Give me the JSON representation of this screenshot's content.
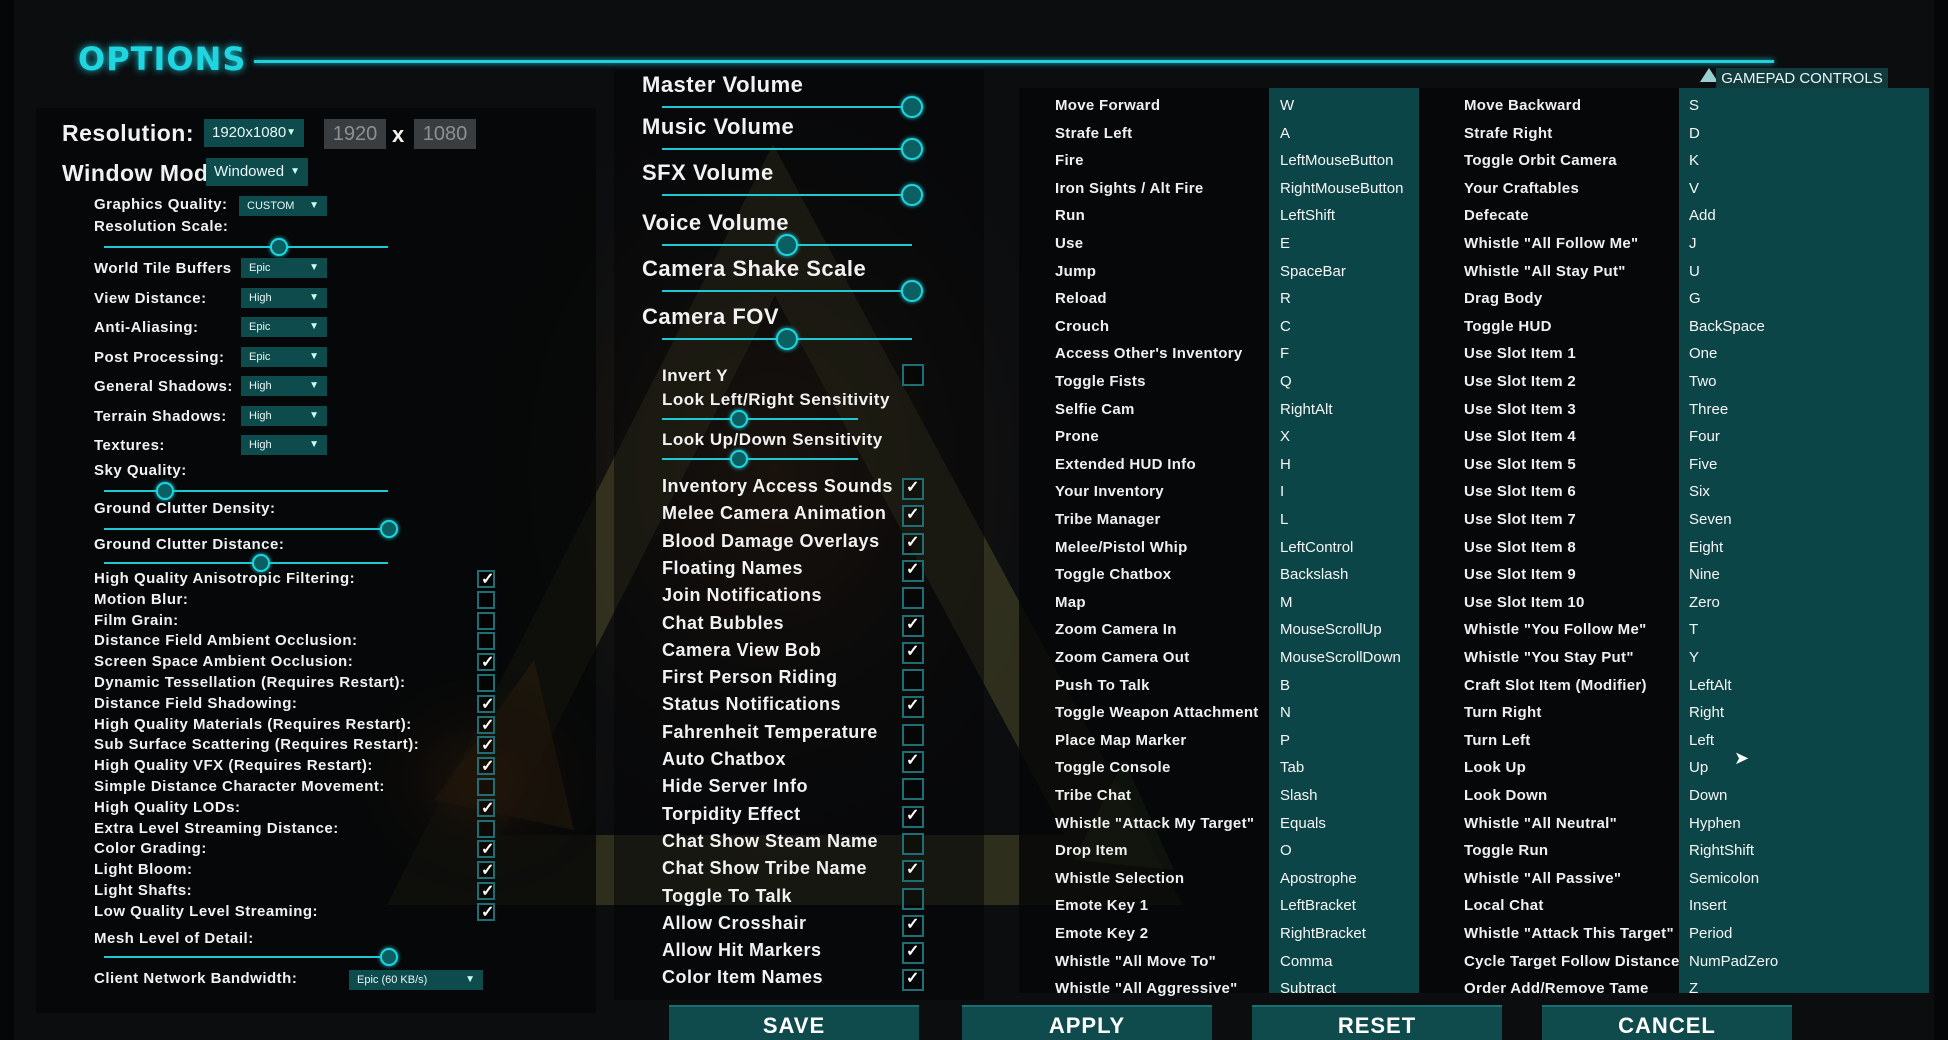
{
  "header": {
    "title": "OPTIONS",
    "gamepad_label": "GAMEPAD CONTROLS"
  },
  "display": {
    "resolution_label": "Resolution:",
    "resolution_value": "1920x1080",
    "res_w": "1920",
    "res_x": "x",
    "res_h": "1080",
    "window_mode_label": "Window Mode:",
    "window_mode_value": "Windowed",
    "graphics_quality_label": "Graphics Quality:",
    "graphics_quality_value": "CUSTOM",
    "resolution_scale_label": "Resolution Scale:",
    "quality_rows": [
      {
        "label": "World Tile Buffers",
        "value": "Epic"
      },
      {
        "label": "View Distance:",
        "value": "High"
      },
      {
        "label": "Anti-Aliasing:",
        "value": "Epic"
      },
      {
        "label": "Post Processing:",
        "value": "Epic"
      },
      {
        "label": "General Shadows:",
        "value": "High"
      },
      {
        "label": "Terrain Shadows:",
        "value": "High"
      },
      {
        "label": "Textures:",
        "value": "High"
      }
    ],
    "sky_quality_label": "Sky Quality:",
    "ground_clutter_density_label": "Ground Clutter Density:",
    "ground_clutter_distance_label": "Ground Clutter Distance:",
    "toggles": [
      {
        "label": "High Quality Anisotropic Filtering:",
        "checked": true
      },
      {
        "label": "Motion Blur:",
        "checked": false
      },
      {
        "label": "Film Grain:",
        "checked": false
      },
      {
        "label": "Distance Field Ambient Occlusion:",
        "checked": false
      },
      {
        "label": "Screen Space Ambient Occlusion:",
        "checked": true
      },
      {
        "label": "Dynamic Tessellation (Requires Restart):",
        "checked": false
      },
      {
        "label": "Distance Field Shadowing:",
        "checked": true
      },
      {
        "label": "High Quality Materials (Requires Restart):",
        "checked": true
      },
      {
        "label": "Sub Surface Scattering (Requires Restart):",
        "checked": true
      },
      {
        "label": "High Quality VFX (Requires Restart):",
        "checked": true
      },
      {
        "label": "Simple Distance Character Movement:",
        "checked": false
      },
      {
        "label": "High Quality LODs:",
        "checked": true
      },
      {
        "label": "Extra Level Streaming Distance:",
        "checked": false
      },
      {
        "label": "Color Grading:",
        "checked": true
      },
      {
        "label": "Light Bloom:",
        "checked": true
      },
      {
        "label": "Light Shafts:",
        "checked": true
      },
      {
        "label": "Low Quality Level Streaming:",
        "checked": true
      }
    ],
    "mesh_lod_label": "Mesh Level of Detail:",
    "bandwidth_label": "Client Network Bandwidth:",
    "bandwidth_value": "Epic (60 KB/s)"
  },
  "audio": {
    "master_volume": "Master Volume",
    "music_volume": "Music Volume",
    "sfx_volume": "SFX Volume",
    "voice_volume": "Voice Volume",
    "camera_shake_scale": "Camera Shake Scale",
    "camera_fov": "Camera FOV",
    "invert_y": "Invert Y",
    "look_lr": "Look Left/Right Sensitivity",
    "look_ud": "Look Up/Down Sensitivity",
    "gameplay_toggles": [
      {
        "label": "Inventory Access Sounds",
        "checked": true
      },
      {
        "label": "Melee Camera Animation",
        "checked": true
      },
      {
        "label": "Blood Damage Overlays",
        "checked": true
      },
      {
        "label": "Floating Names",
        "checked": true
      },
      {
        "label": "Join Notifications",
        "checked": false
      },
      {
        "label": "Chat Bubbles",
        "checked": true
      },
      {
        "label": "Camera View Bob",
        "checked": true
      },
      {
        "label": "First Person Riding",
        "checked": false
      },
      {
        "label": "Status Notifications",
        "checked": true
      },
      {
        "label": "Fahrenheit Temperature",
        "checked": false
      },
      {
        "label": "Auto Chatbox",
        "checked": true
      },
      {
        "label": "Hide Server Info",
        "checked": false
      },
      {
        "label": "Torpidity Effect",
        "checked": true
      },
      {
        "label": "Chat Show Steam Name",
        "checked": false
      },
      {
        "label": "Chat Show Tribe Name",
        "checked": true
      },
      {
        "label": "Toggle To Talk",
        "checked": false
      },
      {
        "label": "Allow Crosshair",
        "checked": true
      },
      {
        "label": "Allow Hit Markers",
        "checked": true
      },
      {
        "label": "Color Item Names",
        "checked": true
      }
    ]
  },
  "keybinds_left": [
    [
      "Move Forward",
      "W"
    ],
    [
      "Strafe Left",
      "A"
    ],
    [
      "Fire",
      "LeftMouseButton"
    ],
    [
      "Iron Sights / Alt Fire",
      "RightMouseButton"
    ],
    [
      "Run",
      "LeftShift"
    ],
    [
      "Use",
      "E"
    ],
    [
      "Jump",
      "SpaceBar"
    ],
    [
      "Reload",
      "R"
    ],
    [
      "Crouch",
      "C"
    ],
    [
      "Access Other's Inventory",
      "F"
    ],
    [
      "Toggle Fists",
      "Q"
    ],
    [
      "Selfie Cam",
      "RightAlt"
    ],
    [
      "Prone",
      "X"
    ],
    [
      "Extended HUD Info",
      "H"
    ],
    [
      "Your Inventory",
      "I"
    ],
    [
      "Tribe Manager",
      "L"
    ],
    [
      "Melee/Pistol Whip",
      "LeftControl"
    ],
    [
      "Toggle Chatbox",
      "Backslash"
    ],
    [
      "Map",
      "M"
    ],
    [
      "Zoom Camera In",
      "MouseScrollUp"
    ],
    [
      "Zoom Camera Out",
      "MouseScrollDown"
    ],
    [
      "Push To Talk",
      "B"
    ],
    [
      "Toggle Weapon Attachment",
      "N"
    ],
    [
      "Place Map Marker",
      "P"
    ],
    [
      "Toggle Console",
      "Tab"
    ],
    [
      "Tribe Chat",
      "Slash"
    ],
    [
      "Whistle \"Attack My Target\"",
      "Equals"
    ],
    [
      "Drop Item",
      "O"
    ],
    [
      "Whistle Selection",
      "Apostrophe"
    ],
    [
      "Emote Key 1",
      "LeftBracket"
    ],
    [
      "Emote Key 2",
      "RightBracket"
    ],
    [
      "Whistle \"All Move To\"",
      "Comma"
    ],
    [
      "Whistle \"All Aggressive\"",
      "Subtract"
    ]
  ],
  "keybinds_right": [
    [
      "Move Backward",
      "S"
    ],
    [
      "Strafe Right",
      "D"
    ],
    [
      "Toggle Orbit Camera",
      "K"
    ],
    [
      "Your Craftables",
      "V"
    ],
    [
      "Defecate",
      "Add"
    ],
    [
      "Whistle \"All Follow Me\"",
      "J"
    ],
    [
      "Whistle \"All Stay Put\"",
      "U"
    ],
    [
      "Drag Body",
      "G"
    ],
    [
      "Toggle HUD",
      "BackSpace"
    ],
    [
      "Use Slot Item 1",
      "One"
    ],
    [
      "Use Slot Item 2",
      "Two"
    ],
    [
      "Use Slot Item 3",
      "Three"
    ],
    [
      "Use Slot Item 4",
      "Four"
    ],
    [
      "Use Slot Item 5",
      "Five"
    ],
    [
      "Use Slot Item 6",
      "Six"
    ],
    [
      "Use Slot Item 7",
      "Seven"
    ],
    [
      "Use Slot Item 8",
      "Eight"
    ],
    [
      "Use Slot Item 9",
      "Nine"
    ],
    [
      "Use Slot Item 10",
      "Zero"
    ],
    [
      "Whistle \"You Follow Me\"",
      "T"
    ],
    [
      "Whistle \"You Stay Put\"",
      "Y"
    ],
    [
      "Craft Slot Item (Modifier)",
      "LeftAlt"
    ],
    [
      "Turn Right",
      "Right"
    ],
    [
      "Turn Left",
      "Left"
    ],
    [
      "Look Up",
      "Up"
    ],
    [
      "Look Down",
      "Down"
    ],
    [
      "Whistle \"All Neutral\"",
      "Hyphen"
    ],
    [
      "Toggle Run",
      "RightShift"
    ],
    [
      "Whistle \"All Passive\"",
      "Semicolon"
    ],
    [
      "Local Chat",
      "Insert"
    ],
    [
      "Whistle \"Attack This Target\"",
      "Period"
    ],
    [
      "Cycle Target Follow Distance",
      "NumPadZero"
    ],
    [
      "Order Add/Remove Tame",
      "Z"
    ]
  ],
  "footer": {
    "save": "SAVE",
    "apply": "APPLY",
    "reset": "RESET",
    "cancel": "CANCEL"
  },
  "colors": {
    "accent": "#1ed1dd",
    "button": "#0f4a4c",
    "key_strip": "#0c4547"
  }
}
